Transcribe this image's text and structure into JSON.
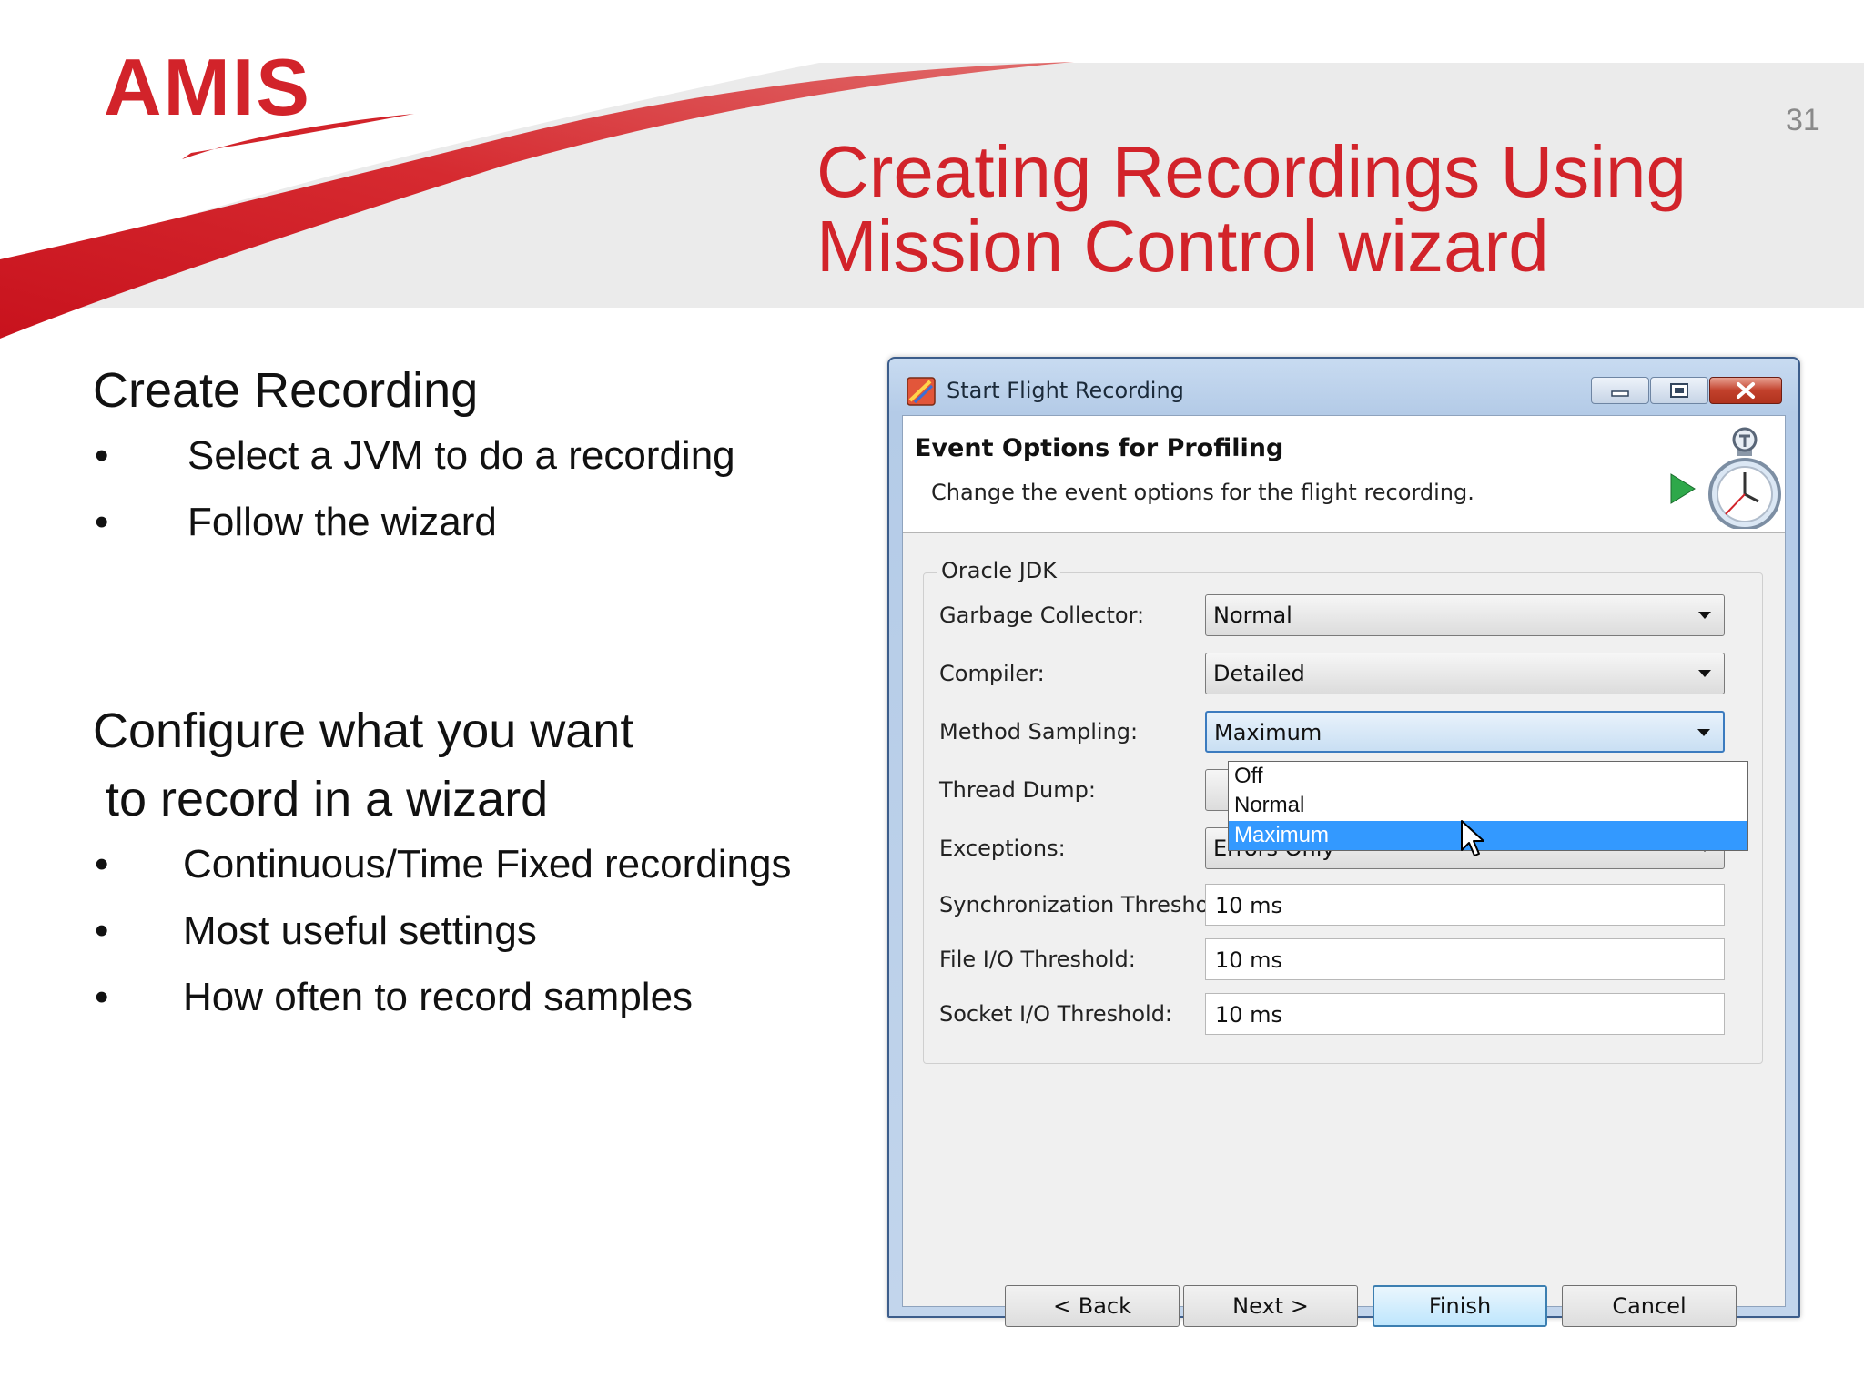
{
  "slide": {
    "logo": "AMIS",
    "page_number": "31",
    "title_line1": "Creating Recordings Using",
    "title_line2": "Mission Control wizard",
    "section1": {
      "heading": "Create Recording",
      "bullets": [
        "Select a JVM to do a recording",
        "Follow the wizard"
      ]
    },
    "section2": {
      "heading_line1": "Configure what you want",
      "heading_line2": "to record in a wizard",
      "bullets": [
        "Continuous/Time Fixed recordings",
        "Most useful settings",
        "How often to record samples"
      ]
    },
    "colors": {
      "brand_red": "#d2232a",
      "banner_gray": "#ececec"
    }
  },
  "dialog": {
    "title": "Start Flight Recording",
    "page_heading": "Event Options for Profiling",
    "page_description": "Change the event options for the flight recording.",
    "group_label": "Oracle JDK",
    "fields": [
      {
        "label": "Garbage Collector:",
        "value": "Normal"
      },
      {
        "label": "Compiler:",
        "value": "Detailed"
      },
      {
        "label": "Method Sampling:",
        "value": "Maximum"
      },
      {
        "label": "Thread Dump:",
        "value": ""
      },
      {
        "label": "Exceptions:",
        "value": "Errors Only"
      },
      {
        "label": "Synchronization Threshold:",
        "value": "10 ms"
      },
      {
        "label": "File I/O Threshold:",
        "value": "10 ms"
      },
      {
        "label": "Socket I/O Threshold:",
        "value": "10 ms"
      }
    ],
    "dropdown_options": [
      "Off",
      "Normal",
      "Maximum"
    ],
    "dropdown_selected": "Maximum",
    "buttons": {
      "back": "< Back",
      "next": "Next >",
      "finish": "Finish",
      "cancel": "Cancel"
    },
    "icons": [
      "minimize-icon",
      "maximize-icon",
      "close-icon",
      "flight-recorder-app-icon",
      "stopwatch-icon",
      "mouse-pointer-icon"
    ]
  }
}
